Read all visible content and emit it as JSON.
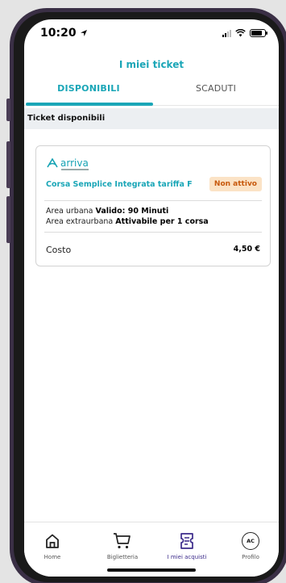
{
  "status_bar": {
    "time": "10:20"
  },
  "header": {
    "title": "I miei ticket"
  },
  "tabs": [
    {
      "label": "DISPONIBILI",
      "active": true
    },
    {
      "label": "SCADUTI",
      "active": false
    }
  ],
  "section": {
    "title": "Ticket disponibili"
  },
  "ticket": {
    "operator_logo": "arriva",
    "name": "Corsa Semplice Integrata tariffa F",
    "status_badge": "Non attivo",
    "urban_label": "Area urbana",
    "urban_value": "Valido: 90 Minuti",
    "extraurban_label": "Area extraurbana",
    "extraurban_value": "Attivabile per 1 corsa",
    "cost_label": "Costo",
    "cost_value": "4,50 €"
  },
  "nav": {
    "home": "Home",
    "shop": "Biglietteria",
    "tickets": "I miei acquisti",
    "profile": "Profilo",
    "avatar_initials": "AC"
  },
  "colors": {
    "accent": "#1aa6b7",
    "badge_bg": "#fbe3c6",
    "badge_text": "#c7590c",
    "nav_active": "#3b2a8a"
  }
}
